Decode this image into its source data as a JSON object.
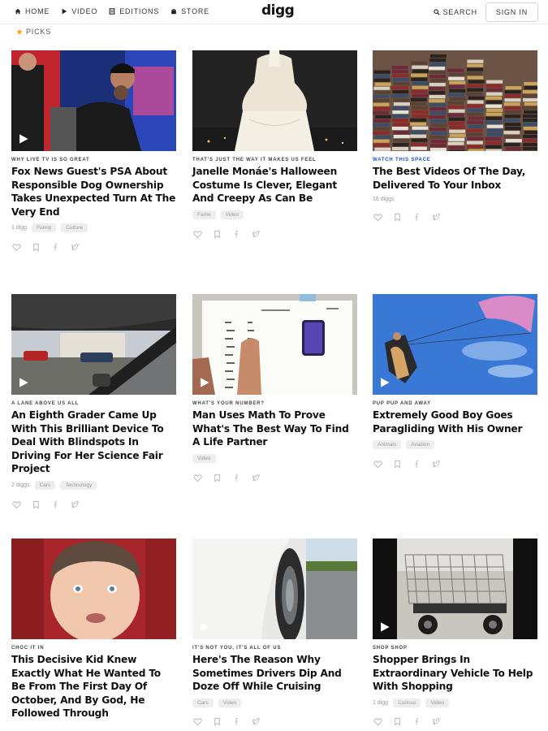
{
  "nav": {
    "home": "HOME",
    "video": "VIDEO",
    "editions": "EDITIONS",
    "store": "STORE",
    "logo": "digg",
    "search": "SEARCH",
    "signin": "SIGN IN"
  },
  "section": {
    "label": "PICKS",
    "icon": "star-icon"
  },
  "colors": {
    "accent_blue": "#1a4fc4",
    "star": "#f5a623"
  },
  "cards": [
    {
      "kicker": "WHY LIVE TV IS SO GREAT",
      "headline": "Fox News Guest's PSA About Responsible Dog Ownership Takes Unexpected Turn At The Very End",
      "diggs": "1 digg",
      "tags": [
        "Funny",
        "Culture"
      ],
      "video": true
    },
    {
      "kicker": "THAT'S JUST THE WAY IT MAKES US FEEL",
      "headline": "Janelle Monáe's Halloween Costume Is Clever, Elegant And Creepy As Can Be",
      "diggs": "",
      "tags": [
        "Fame",
        "Video"
      ],
      "video": false
    },
    {
      "kicker": "WATCH THIS SPACE",
      "headline": "The Best Videos Of The Day, Delivered To Your Inbox",
      "diggs": "16 diggs",
      "tags": [],
      "video": false
    },
    {
      "kicker": "A LANE ABOVE US ALL",
      "headline": "An Eighth Grader Came Up With This Brilliant Device To Deal With Blindspots In Driving For Her Science Fair Project",
      "diggs": "2 diggs",
      "tags": [
        "Cars",
        "Technology"
      ],
      "video": true
    },
    {
      "kicker": "WHAT'S YOUR NUMBER?",
      "headline": "Man Uses Math To Prove What's The Best Way To Find A Life Partner",
      "diggs": "",
      "tags": [
        "Video"
      ],
      "video": true
    },
    {
      "kicker": "PUP PUP AND AWAY",
      "headline": "Extremely Good Boy Goes Paragliding With His Owner",
      "diggs": "",
      "tags": [
        "Animals",
        "Aviation"
      ],
      "video": true
    },
    {
      "kicker": "CHOC IT IN",
      "headline": "This Decisive Kid Knew Exactly What He Wanted To Be From The First Day Of October, And By God, He Followed Through",
      "diggs": "",
      "tags": [],
      "video": false
    },
    {
      "kicker": "IT'S NOT YOU, IT'S ALL OF US",
      "headline": "Here's The Reason Why Sometimes Drivers Dip And Doze Off While Cruising",
      "diggs": "",
      "tags": [
        "Cars",
        "Video"
      ],
      "video": true
    },
    {
      "kicker": "SHOP SHOP",
      "headline": "Shopper Brings In Extraordinary Vehicle To Help With Shopping",
      "diggs": "1 digg",
      "tags": [
        "Curious",
        "Video"
      ],
      "video": true
    }
  ]
}
